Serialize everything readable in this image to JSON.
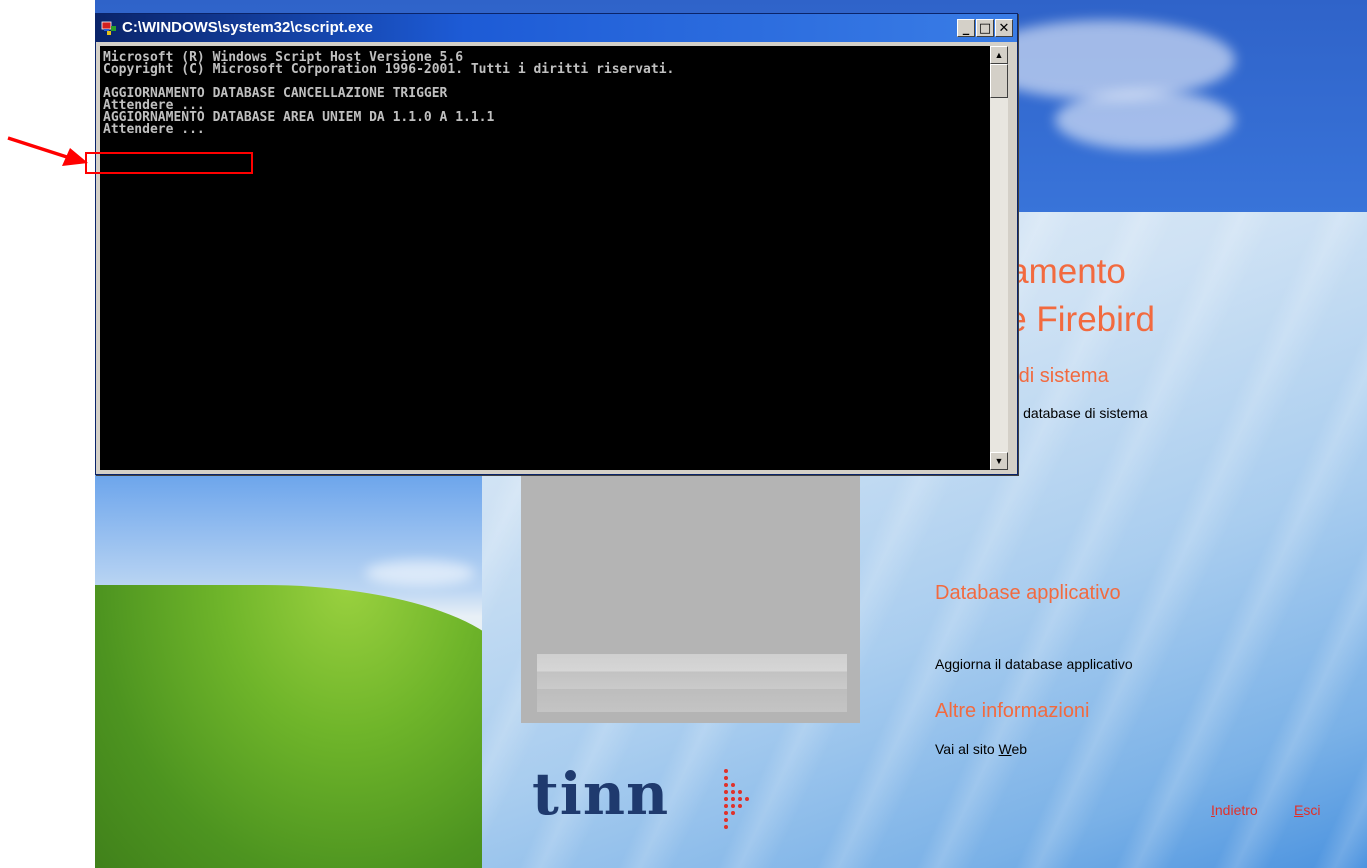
{
  "console": {
    "title": "C:\\WINDOWS\\system32\\cscript.exe",
    "lines": [
      "Microsoft (R) Windows Script Host Versione 5.6",
      "Copyright (C) Microsoft Corporation 1996-2001. Tutti i diritti riservati.",
      "",
      "AGGIORNAMENTO DATABASE CANCELLAZIONE TRIGGER",
      "Attendere ...",
      "AGGIORNAMENTO DATABASE AREA UNIEM DA 1.1.0 A 1.1.1",
      "Attendere ..."
    ],
    "buttons": {
      "minimize": "_",
      "maximize": "□",
      "close": "✕"
    }
  },
  "app": {
    "title_line1": "rnamento",
    "title_line2": "nte Firebird",
    "section_system": "se di sistema",
    "system_link": "ento database di sistema",
    "section_database": "Database applicativo",
    "database_link": "Aggiorna il database applicativo",
    "section_info": "Altre informazioni",
    "web_link_prefix": "Vai al sito ",
    "web_link_underlined": "W",
    "web_link_suffix": "eb",
    "back": "Indietro",
    "exit": "Esci",
    "logo": "tinn"
  },
  "colors": {
    "accent": "#f26a3f",
    "link_red": "#e0312a",
    "console_bg": "#000000",
    "console_fg": "#c0c0c0",
    "titlebar": "#0a246a",
    "highlight": "#ff0000"
  },
  "icons": [
    "console-app-icon",
    "minimize-icon",
    "maximize-icon",
    "close-icon",
    "scroll-up-icon",
    "scroll-down-icon",
    "annotation-arrow-icon"
  ]
}
